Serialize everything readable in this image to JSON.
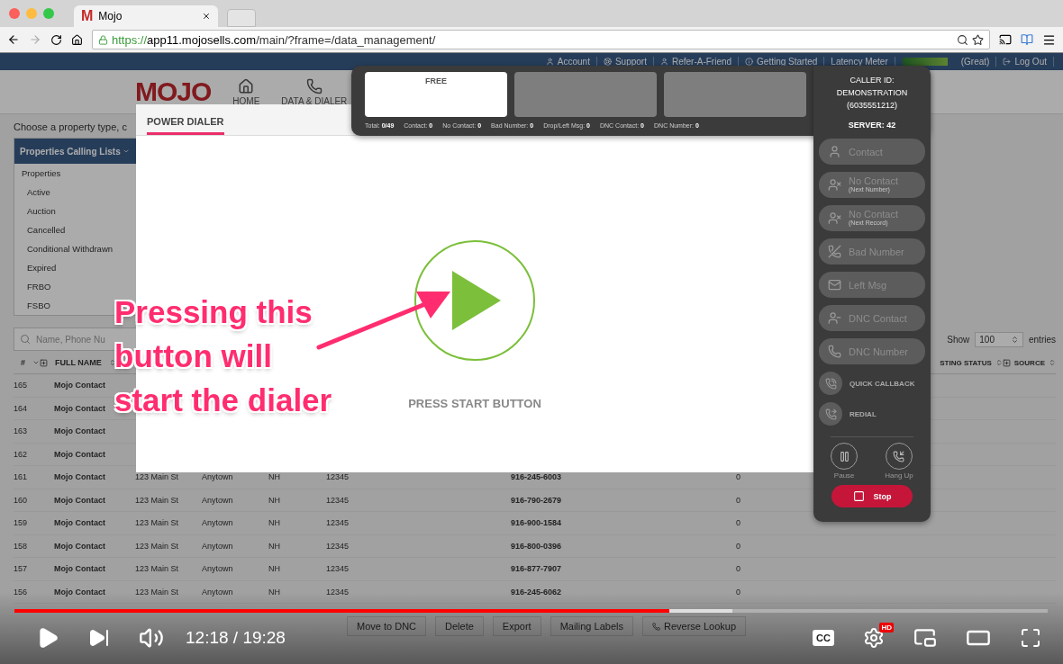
{
  "browser": {
    "tab_icon": "M",
    "tab_title": "Mojo",
    "url_scheme": "https://",
    "url_host": "app11.mojosells.com",
    "url_path": "/main/?frame=/data_management/"
  },
  "top_bar": {
    "links": [
      {
        "label": "Account",
        "kind": "user"
      },
      {
        "label": "Support",
        "kind": "support"
      },
      {
        "label": "Refer-A-Friend",
        "kind": "user"
      },
      {
        "label": "Getting Started",
        "kind": "info"
      }
    ],
    "latency_label": "Latency Meter",
    "latency_status": "(Great)",
    "logout": "Log Out"
  },
  "header": {
    "logo": "MOJO",
    "nav": [
      {
        "label": "HOME",
        "kind": "home"
      },
      {
        "label": "DATA & DIALER",
        "kind": "dialer"
      }
    ]
  },
  "page": {
    "prompt": "Choose a property type, c",
    "list_title": "Properties Calling Lists",
    "list_group": "Properties",
    "list_items": [
      "Active",
      "Auction",
      "Cancelled",
      "Conditional Withdrawn",
      "Expired",
      "FRBO",
      "FSBO"
    ],
    "search_placeholder": "Name, Phone Nu",
    "show_label": "Show",
    "show_value": "100",
    "entries_label": "entries"
  },
  "table": {
    "columns_left": [
      "#",
      "FULL NAME"
    ],
    "columns_right": [
      "STING STATUS",
      "SOURCE"
    ],
    "rows": [
      {
        "cells": [
          "165",
          "Mojo Contact"
        ]
      },
      {
        "cells": [
          "164",
          "Mojo Contact"
        ]
      },
      {
        "cells": [
          "163",
          "Mojo Contact"
        ]
      },
      {
        "cells": [
          "162",
          "Mojo Contact"
        ]
      },
      {
        "cells": [
          "161",
          "Mojo Contact",
          "123 Main St",
          "Anytown",
          "NH",
          "12345",
          "916-245-6003",
          "0"
        ]
      },
      {
        "cells": [
          "160",
          "Mojo Contact",
          "123 Main St",
          "Anytown",
          "NH",
          "12345",
          "916-790-2679",
          "0"
        ]
      },
      {
        "cells": [
          "159",
          "Mojo Contact",
          "123 Main St",
          "Anytown",
          "NH",
          "12345",
          "916-900-1584",
          "0"
        ]
      },
      {
        "cells": [
          "158",
          "Mojo Contact",
          "123 Main St",
          "Anytown",
          "NH",
          "12345",
          "916-800-0396",
          "0"
        ]
      },
      {
        "cells": [
          "157",
          "Mojo Contact",
          "123 Main St",
          "Anytown",
          "NH",
          "12345",
          "916-877-7907",
          "0"
        ]
      },
      {
        "cells": [
          "156",
          "Mojo Contact",
          "123 Main St",
          "Anytown",
          "NH",
          "12345",
          "916-245-6062",
          "0"
        ]
      }
    ]
  },
  "bulk_actions": [
    {
      "label": "Move to DNC",
      "kind": "plain"
    },
    {
      "label": "Delete",
      "kind": "plain"
    },
    {
      "label": "Export",
      "kind": "plain"
    },
    {
      "label": "Mailing Labels",
      "kind": "plain"
    },
    {
      "label": "Reverse Lookup",
      "kind": "lookup"
    }
  ],
  "dialer": {
    "title": "POWER DIALER",
    "lines": [
      {
        "label": "FREE",
        "kind": "free"
      },
      {
        "kind": "empty"
      },
      {
        "kind": "empty"
      }
    ],
    "stats": [
      {
        "label": "Total:",
        "value": "0/49"
      },
      {
        "label": "Contact:",
        "value": "0"
      },
      {
        "label": "No Contact:",
        "value": "0"
      },
      {
        "label": "Bad Number:",
        "value": "0"
      },
      {
        "label": "Drop/Left Msg:",
        "value": "0"
      },
      {
        "label": "DNC Contact:",
        "value": "0"
      },
      {
        "label": "DNC Number:",
        "value": "0"
      }
    ],
    "start_label": "PRESS START BUTTON",
    "caller_id_label": "CALLER ID:",
    "caller_name": "DEMONSTRATION",
    "caller_number": "(6035551212)",
    "server": "SERVER: 42",
    "dispositions": [
      {
        "label": "Contact",
        "kind": "person"
      },
      {
        "label": "No Contact",
        "sub": "(Next Number)",
        "kind": "person-x"
      },
      {
        "label": "No Contact",
        "sub": "(Next Record)",
        "kind": "person-x"
      },
      {
        "label": "Bad Number",
        "kind": "phone-x"
      },
      {
        "label": "Left Msg",
        "kind": "mail"
      },
      {
        "label": "DNC Contact",
        "kind": "person-off"
      },
      {
        "label": "DNC Number",
        "kind": "desk-phone"
      }
    ],
    "quick": [
      {
        "label": "QUICK CALLBACK",
        "kind": "callback"
      },
      {
        "label": "REDIAL",
        "kind": "redial"
      }
    ],
    "controls": [
      {
        "label": "Pause",
        "kind": "pause"
      },
      {
        "label": "Hang Up",
        "kind": "hangup"
      }
    ],
    "stop": "Stop"
  },
  "annotation": {
    "lines": [
      "Pressing this",
      "button will",
      "start the dialer"
    ]
  },
  "video": {
    "time": "12:18 / 19:28",
    "progress": {
      "level": 0.634
    },
    "buffer": {
      "level": 0.695
    },
    "cc": "CC",
    "hd_badge": "HD"
  }
}
